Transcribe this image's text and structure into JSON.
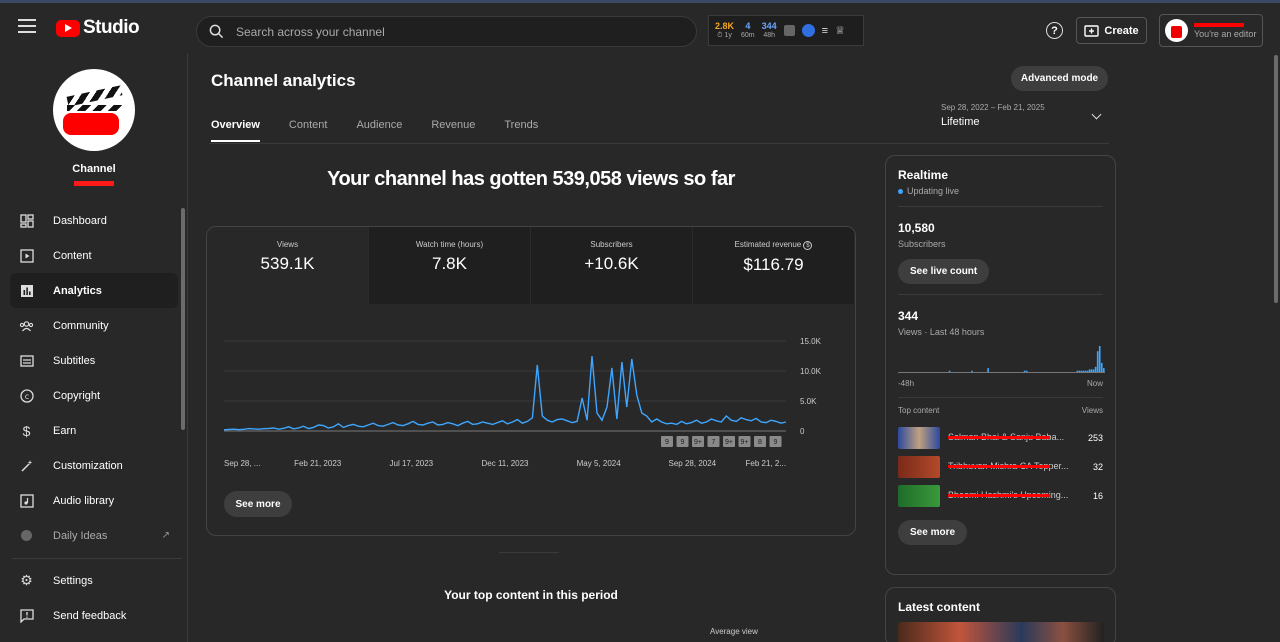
{
  "app": {
    "brand": "Studio"
  },
  "search": {
    "placeholder": "Search across your channel"
  },
  "extension": {
    "stats": [
      {
        "value": "2.8K",
        "sub": "1y",
        "color": "#f5a623"
      },
      {
        "value": "4",
        "sub": "60m",
        "color": "#6aa6ff"
      },
      {
        "value": "344",
        "sub": "48h",
        "color": "#6aa6ff"
      }
    ]
  },
  "header": {
    "create_label": "Create",
    "account_role": "You're an editor"
  },
  "channel": {
    "name": "Channel"
  },
  "sidebar": {
    "items": [
      {
        "label": "Dashboard",
        "icon": "dashboard-icon",
        "active": false
      },
      {
        "label": "Content",
        "icon": "content-icon",
        "active": false
      },
      {
        "label": "Analytics",
        "icon": "analytics-icon",
        "active": true
      },
      {
        "label": "Community",
        "icon": "community-icon",
        "active": false
      },
      {
        "label": "Subtitles",
        "icon": "subtitles-icon",
        "active": false
      },
      {
        "label": "Copyright",
        "icon": "copyright-icon",
        "active": false
      },
      {
        "label": "Earn",
        "icon": "earn-icon",
        "active": false
      },
      {
        "label": "Customization",
        "icon": "customization-icon",
        "active": false
      },
      {
        "label": "Audio library",
        "icon": "audio-library-icon",
        "active": false
      },
      {
        "label": "Daily Ideas",
        "icon": "daily-ideas-icon",
        "active": false
      }
    ],
    "bottom": [
      {
        "label": "Settings",
        "icon": "settings-icon"
      },
      {
        "label": "Send feedback",
        "icon": "feedback-icon"
      }
    ]
  },
  "page": {
    "title": "Channel analytics",
    "advanced_label": "Advanced mode",
    "tabs": [
      "Overview",
      "Content",
      "Audience",
      "Revenue",
      "Trends"
    ],
    "date_range": "Sep 28, 2022 – Feb 21, 2025",
    "period": "Lifetime",
    "headline": "Your channel has gotten 539,058 views so far",
    "see_more": "See more",
    "top_content_title": "Your top content in this period",
    "avg_view": "Average view"
  },
  "metrics": [
    {
      "label": "Views",
      "value": "539.1K"
    },
    {
      "label": "Watch time (hours)",
      "value": "7.8K"
    },
    {
      "label": "Subscribers",
      "value": "+10.6K"
    },
    {
      "label": "Estimated revenue",
      "value": "$116.79"
    }
  ],
  "chart_data": {
    "type": "line",
    "x_labels": [
      "Sep 28, ...",
      "Feb 21, 2023",
      "Jul 17, 2023",
      "Dec 11, 2023",
      "May 5, 2024",
      "Sep 28, 2024",
      "Feb 21, 2..."
    ],
    "y_ticks": [
      "15.0K",
      "10.0K",
      "5.0K",
      "0"
    ],
    "ylim": [
      0,
      15000
    ],
    "series": [
      {
        "color": "#3ea6ff",
        "values": [
          200,
          250,
          300,
          220,
          280,
          400,
          350,
          300,
          380,
          420,
          500,
          300,
          450,
          700,
          350,
          500,
          800,
          400,
          600,
          1000,
          900,
          500,
          700,
          1200,
          600,
          900,
          1100,
          800,
          700,
          1000,
          1300,
          900,
          800,
          1100,
          1400,
          1000,
          900,
          1200,
          1600,
          1100,
          1000,
          1300,
          1500,
          1000,
          1100,
          1400,
          1200,
          900,
          1300,
          1600,
          1100,
          1200,
          1500,
          1300,
          1100,
          1400,
          1700,
          1200,
          1500,
          1900,
          1300,
          1600,
          2200,
          11000,
          2500,
          1800,
          1500,
          1900,
          2000,
          1700,
          1400,
          1600,
          5500,
          1800,
          12500,
          3000,
          1800,
          4000,
          10500,
          2000,
          11500,
          4000,
          12000,
          6000,
          3000,
          2500,
          1500,
          2000,
          1500,
          1200,
          1300,
          1100,
          1600,
          1200,
          1400,
          1800,
          1300,
          1500,
          2000,
          1700,
          1500,
          2500,
          1800,
          1600,
          2200,
          1900,
          1700,
          2100,
          1500,
          1400,
          1800,
          1600,
          1300,
          1500
        ]
      }
    ],
    "markers": [
      "9",
      "9",
      "9+",
      "7",
      "9+",
      "9+",
      "8",
      "9"
    ]
  },
  "realtime": {
    "title": "Realtime",
    "status": "Updating live",
    "subscribers_value": "10,580",
    "subscribers_label": "Subscribers",
    "live_count_label": "See live count",
    "views_value": "344",
    "views_label": "Views · Last 48 hours",
    "axis_start": "-48h",
    "axis_end": "Now",
    "top_content_label": "Top content",
    "views_col": "Views",
    "bars": [
      0,
      0,
      0,
      0,
      0,
      0,
      0,
      0,
      0,
      0,
      0,
      0,
      0,
      0,
      0,
      0,
      0,
      0,
      0,
      0,
      0,
      0,
      0,
      0,
      0,
      1,
      0,
      0,
      0,
      0,
      0,
      0,
      0,
      0,
      0,
      0,
      1,
      0,
      0,
      0,
      0,
      0,
      0,
      0,
      3,
      0,
      0,
      0,
      0,
      0,
      0,
      0,
      0,
      0,
      0,
      0,
      0,
      0,
      0,
      0,
      0,
      0,
      1,
      1,
      0,
      0,
      0,
      0,
      0,
      0,
      0,
      0,
      0,
      0,
      0,
      0,
      0,
      0,
      0,
      0,
      0,
      0,
      0,
      0,
      0,
      0,
      0,
      0,
      1,
      1,
      1,
      1,
      1,
      1,
      2,
      2,
      2,
      4,
      16,
      20,
      7,
      3
    ],
    "items": [
      {
        "title": "Salman Bhai & Sanju Baba...",
        "views": "253",
        "thumb": "#2b4a9e"
      },
      {
        "title": "Tribhuvan Mishra CA Topper...",
        "views": "32",
        "thumb": "#7a2a1a"
      },
      {
        "title": "Bhoomi Hashmi's Upcoming...",
        "views": "16",
        "thumb": "#1f6b2a"
      }
    ],
    "see_more": "See more"
  },
  "latest": {
    "title": "Latest content"
  }
}
